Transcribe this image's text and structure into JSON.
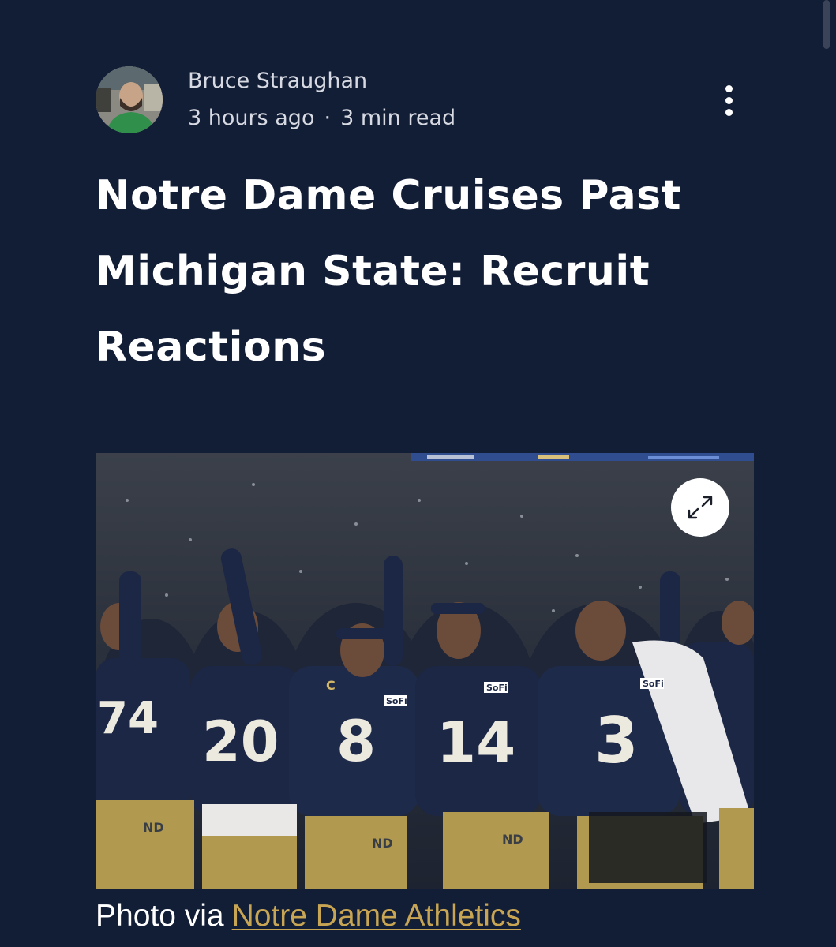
{
  "author": {
    "name": "Bruce Straughan",
    "time_ago": "3 hours ago",
    "separator": "·",
    "read_time": "3 min read",
    "avatar_icon": "author-avatar"
  },
  "menu": {
    "icon": "more-vertical-icon"
  },
  "article": {
    "title": "Notre Dame Cruises Past Michigan State: Recruit Reactions"
  },
  "image": {
    "expand_icon": "expand-icon",
    "jersey_numbers": [
      "74",
      "20",
      "8",
      "14",
      "3"
    ],
    "sponsor_patch": "SoFi",
    "captain_patch": "C",
    "colors": {
      "navy_jersey": "#1c2745",
      "gold_pants": "#b19a4f",
      "stadium": "#303746"
    }
  },
  "caption": {
    "prefix": "Photo via",
    "link_text": "Notre Dame Athletics"
  },
  "colors": {
    "background": "#121d36",
    "text": "#ffffff",
    "meta_text": "#d7dae2",
    "link": "#c7a553"
  }
}
